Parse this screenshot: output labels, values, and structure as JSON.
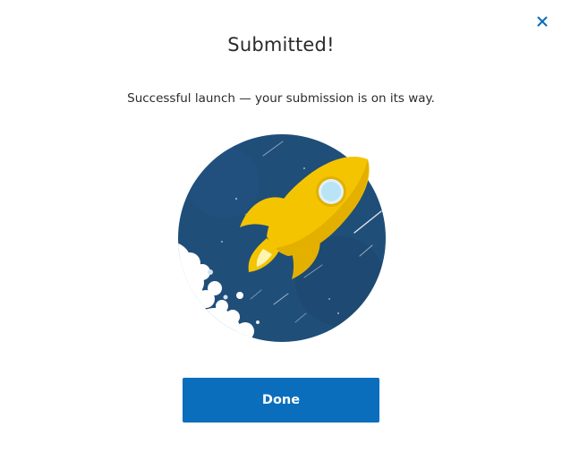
{
  "dialog": {
    "title": "Submitted!",
    "message": "Successful launch — your submission is on its way.",
    "done_label": "Done",
    "close_icon": "close-icon",
    "illustration_icon": "rocket-launch-illustration"
  },
  "colors": {
    "accent": "#0a6ebd",
    "sky": "#1f4e79",
    "rocket": "#f5c400",
    "title_text": "#2b2b2b"
  }
}
